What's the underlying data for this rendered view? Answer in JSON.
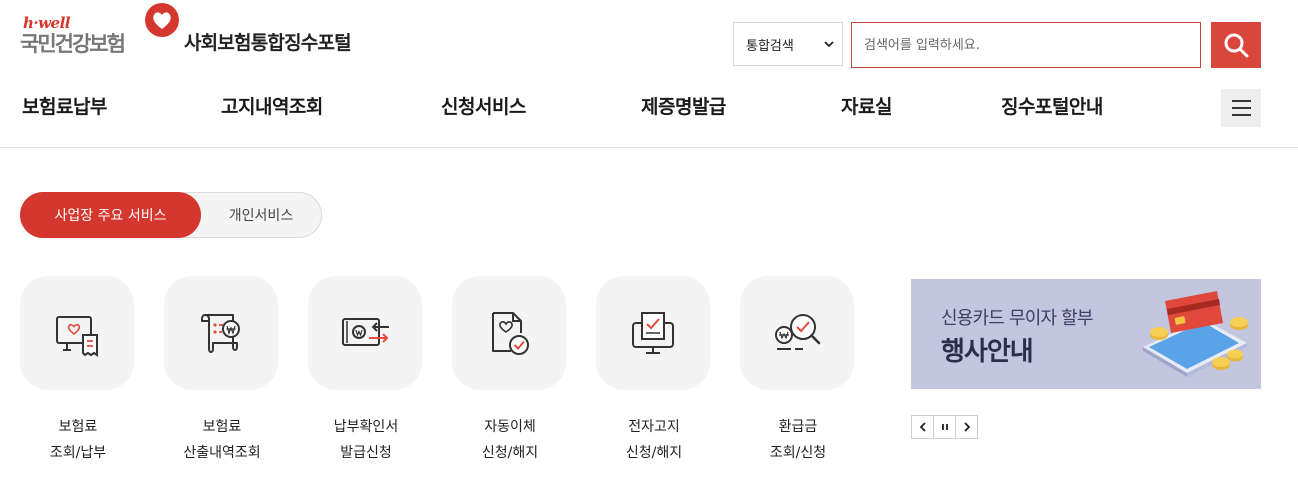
{
  "header": {
    "logo_small": "h·well",
    "logo_org": "국민건강보험",
    "portal_title": "사회보험통합징수포털",
    "search": {
      "scope_selected": "통합검색",
      "placeholder": "검색어를 입력하세요.",
      "button_icon": "search-icon"
    }
  },
  "nav": {
    "items": [
      "보험료납부",
      "고지내역조회",
      "신청서비스",
      "제증명발급",
      "자료실",
      "징수포털안내"
    ],
    "menu_icon": "hamburger-icon"
  },
  "tabs": {
    "active": "사업장 주요 서비스",
    "inactive": "개인서비스"
  },
  "services": [
    {
      "line1": "보험료",
      "line2": "조회/납부",
      "icon": "insurance-bill-icon"
    },
    {
      "line1": "보험료",
      "line2": "산출내역조회",
      "icon": "calculation-list-icon"
    },
    {
      "line1": "납부확인서",
      "line2": "발급신청",
      "icon": "payment-certificate-icon"
    },
    {
      "line1": "자동이체",
      "line2": "신청/해지",
      "icon": "auto-transfer-icon"
    },
    {
      "line1": "전자고지",
      "line2": "신청/해지",
      "icon": "electronic-notice-icon"
    },
    {
      "line1": "환급금",
      "line2": "조회/신청",
      "icon": "refund-search-icon"
    }
  ],
  "banner": {
    "subtitle": "신용카드 무이자 할부",
    "title": "행사안내",
    "background": "#c3c6df"
  },
  "colors": {
    "accent": "#d4372d",
    "tab_bg": "#f4f4f4"
  }
}
